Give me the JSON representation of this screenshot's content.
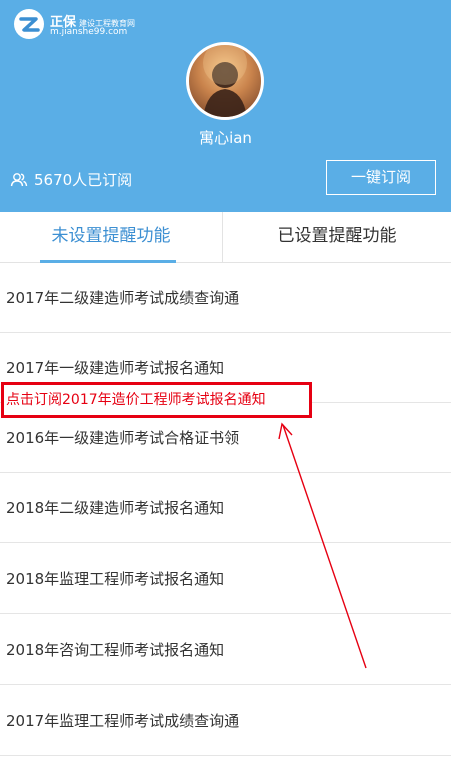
{
  "brand": {
    "name": "正保",
    "subtitle": "建设工程教育网",
    "url": "m.jianshe99.com"
  },
  "profile": {
    "username": "寓心ian",
    "subscriber_count": "5670人已订阅",
    "subscribe_button": "一键订阅"
  },
  "tabs": [
    {
      "label": "未设置提醒功能",
      "active": true
    },
    {
      "label": "已设置提醒功能",
      "active": false
    }
  ],
  "items": [
    {
      "label": "2017年二级建造师考试成绩查询通"
    },
    {
      "label": "2017年一级建造师考试报名通知"
    },
    {
      "label": "2016年一级建造师考试合格证书领"
    },
    {
      "label": "2018年二级建造师考试报名通知"
    },
    {
      "label": "2018年监理工程师考试报名通知"
    },
    {
      "label": "2018年咨询工程师考试报名通知"
    },
    {
      "label": "2017年监理工程师考试成绩查询通"
    }
  ],
  "callout": {
    "text": "点击订阅2017年造价工程师考试报名通知"
  },
  "colors": {
    "header_bg": "#5aaee6",
    "active_tab": "#3c8fd2",
    "callout_red": "#e60012"
  },
  "icons": {
    "logo": "logo-icon",
    "users": "users-icon"
  }
}
